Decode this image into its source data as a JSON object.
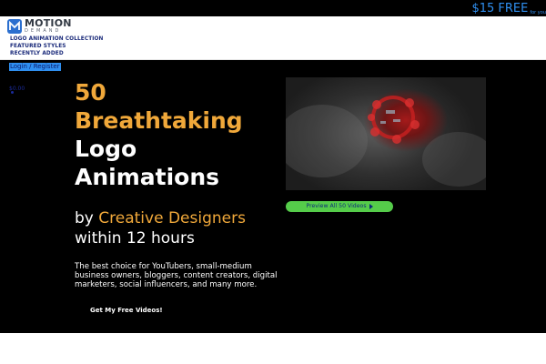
{
  "promo": {
    "price": "$15 FREE",
    "sub": "for you"
  },
  "logo": {
    "word1": "MOTION",
    "word2": "DEMAND",
    "mark": "M"
  },
  "nav": [
    "LOGO ANIMATION COLLECTION",
    "FEATURED STYLES",
    "RECENTLY ADDED"
  ],
  "account": {
    "login": "Login / Register",
    "cart_total": "$0.00"
  },
  "hero": {
    "headline_number": "50",
    "headline_line2": "Breathtaking",
    "headline_line3": "Logo",
    "headline_line4": "Animations",
    "by": "by",
    "creative": "Creative Designers",
    "within": "within 12 hours",
    "description": "The best choice for YouTubers, small-medium business owners, bloggers, content creators, digital marketers, social influencers, and many more.",
    "cta_label": "Get My Free Videos!",
    "preview_label": "Preview All 50 Videos"
  },
  "colors": {
    "accent": "#f0a83a",
    "link_blue": "#2f8ff0",
    "preview_green": "#55cc4a",
    "nav_navy": "#1a2a7a"
  },
  "icons": {
    "preview_button": "play-icon",
    "video": "video-thumbnail"
  }
}
